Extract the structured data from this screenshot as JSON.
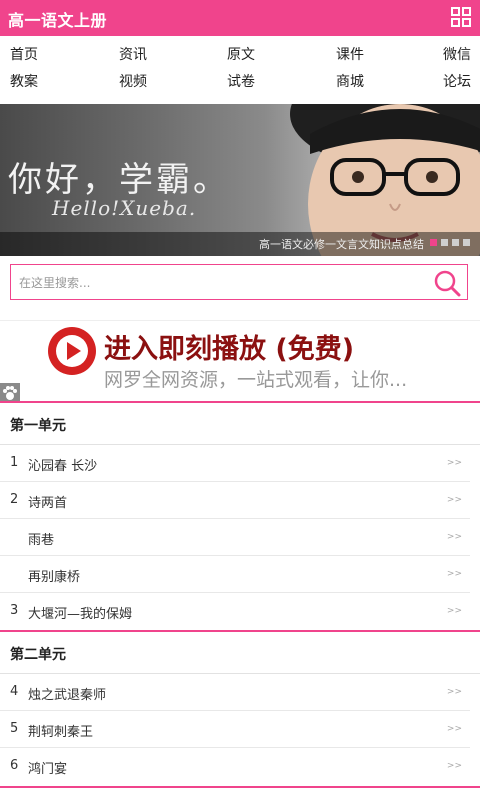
{
  "header": {
    "title": "高一语文上册",
    "menu_icon": "qr-scan-icon",
    "brand_color": "#f0448c"
  },
  "nav": [
    [
      "首页",
      "资讯",
      "原文",
      "课件",
      "微信"
    ],
    [
      "教案",
      "视频",
      "试卷",
      "商城",
      "论坛"
    ]
  ],
  "banner": {
    "big_text": "你好，学霸。",
    "small_text": "Hello!Xueba.",
    "caption": "高一语文必修一文言文知识点总结",
    "slide_count": 4,
    "active_slide": 1
  },
  "search": {
    "placeholder": "在这里搜索...",
    "icon": "search-icon"
  },
  "ad": {
    "headline": "进入即刻播放 (免费)",
    "subtext": "网罗全网资源，一站式观看，让你...",
    "icon": "play-icon"
  },
  "sections": [
    {
      "title": "第一单元",
      "items": [
        {
          "num": "1",
          "title": "沁园春 长沙"
        },
        {
          "num": "2",
          "title": "诗两首"
        },
        {
          "num": "",
          "title": "雨巷"
        },
        {
          "num": "",
          "title": "再别康桥"
        },
        {
          "num": "3",
          "title": "大堰河—我的保姆"
        }
      ]
    },
    {
      "title": "第二单元",
      "items": [
        {
          "num": "4",
          "title": "烛之武退秦师"
        },
        {
          "num": "5",
          "title": "荆轲刺秦王"
        },
        {
          "num": "6",
          "title": "鸿门宴"
        }
      ]
    }
  ],
  "chevron": ">>"
}
